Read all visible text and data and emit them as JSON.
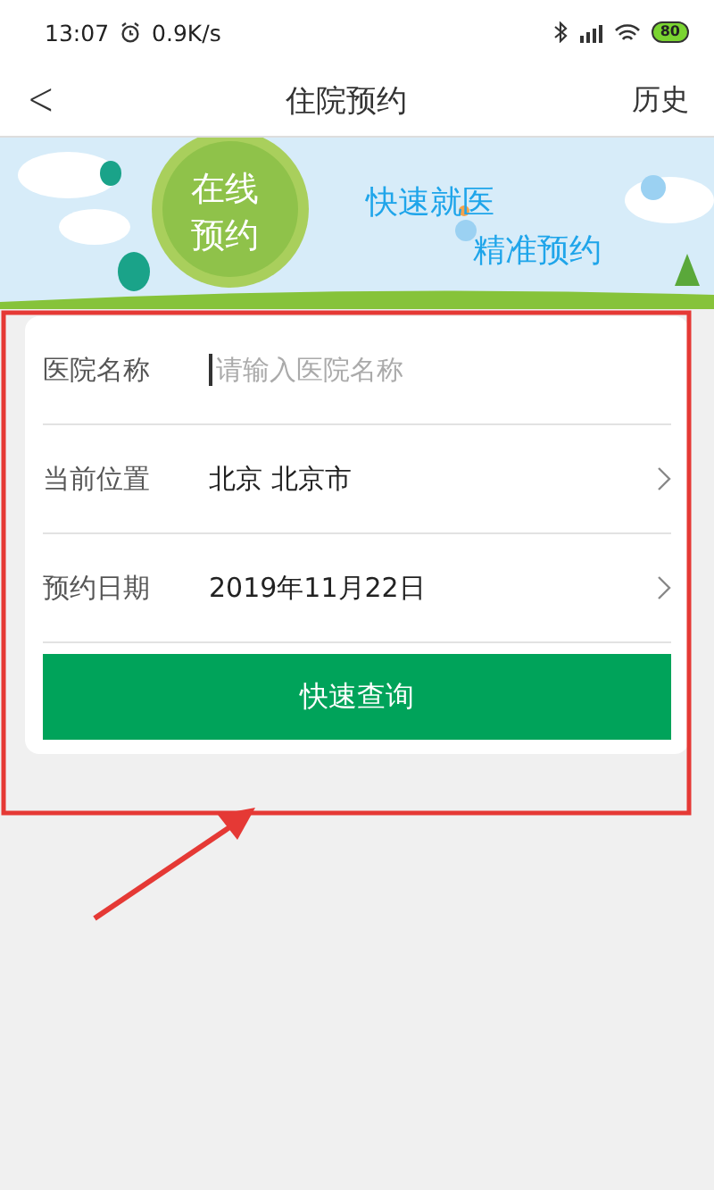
{
  "status_bar": {
    "time": "13:07",
    "speed": "0.9K/s",
    "battery": "80"
  },
  "nav": {
    "back": "<",
    "title": "住院预约",
    "action": "历史"
  },
  "banner": {
    "badge": "在线预约",
    "slogan_1": "快速就医",
    "slogan_2": "精准预约"
  },
  "form": {
    "rows": [
      {
        "kind": "input",
        "label": "医院名称",
        "placeholder": "请输入医院名称",
        "focused": true
      },
      {
        "kind": "select",
        "label": "当前位置",
        "value": "北京  北京市"
      },
      {
        "kind": "select",
        "label": "预约日期",
        "value": "2019年11月22日"
      }
    ],
    "submit": "快速查询"
  }
}
